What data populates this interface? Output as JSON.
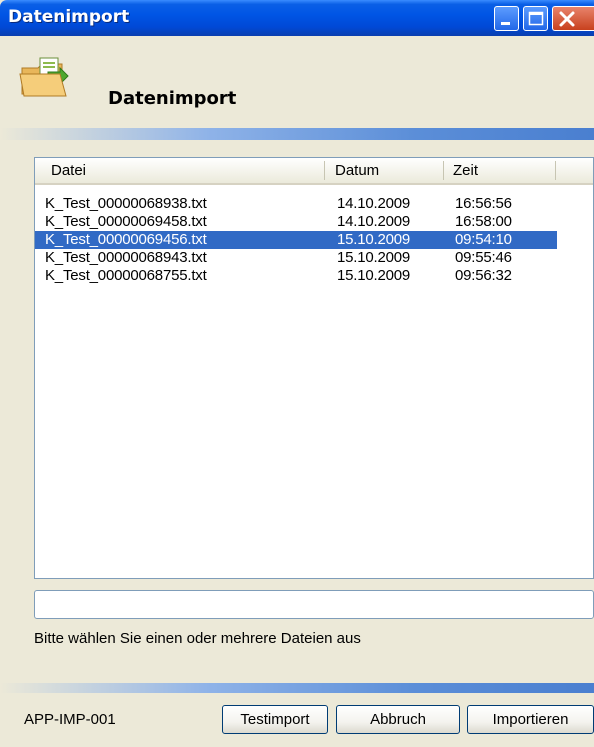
{
  "window": {
    "title": "Datenimport",
    "controls": [
      "minimize-icon",
      "maximize-icon",
      "close-icon"
    ]
  },
  "header": {
    "title": "Datenimport",
    "icon": "folder-import-icon"
  },
  "list": {
    "columns": [
      "Datei",
      "Datum",
      "Zeit"
    ],
    "rows": [
      {
        "file": "K_Test_00000068938.txt",
        "date": "14.10.2009",
        "time": "16:56:56",
        "selected": false
      },
      {
        "file": "K_Test_00000069458.txt",
        "date": "14.10.2009",
        "time": "16:58:00",
        "selected": false
      },
      {
        "file": "K_Test_00000069456.txt",
        "date": "15.10.2009",
        "time": "09:54:10",
        "selected": true
      },
      {
        "file": "K_Test_00000068943.txt",
        "date": "15.10.2009",
        "time": "09:55:46",
        "selected": false
      },
      {
        "file": "K_Test_00000068755.txt",
        "date": "15.10.2009",
        "time": "09:56:32",
        "selected": false
      }
    ]
  },
  "status": {
    "progress_value": "",
    "message": "Bitte wählen Sie einen oder mehrere Dateien aus"
  },
  "footer": {
    "id": "APP-IMP-001",
    "buttons": {
      "test": "Testimport",
      "cancel": "Abbruch",
      "import": "Importieren"
    }
  },
  "colors": {
    "titlebar": "#0055E5",
    "selection": "#316AC5",
    "background": "#ECE9D8"
  }
}
